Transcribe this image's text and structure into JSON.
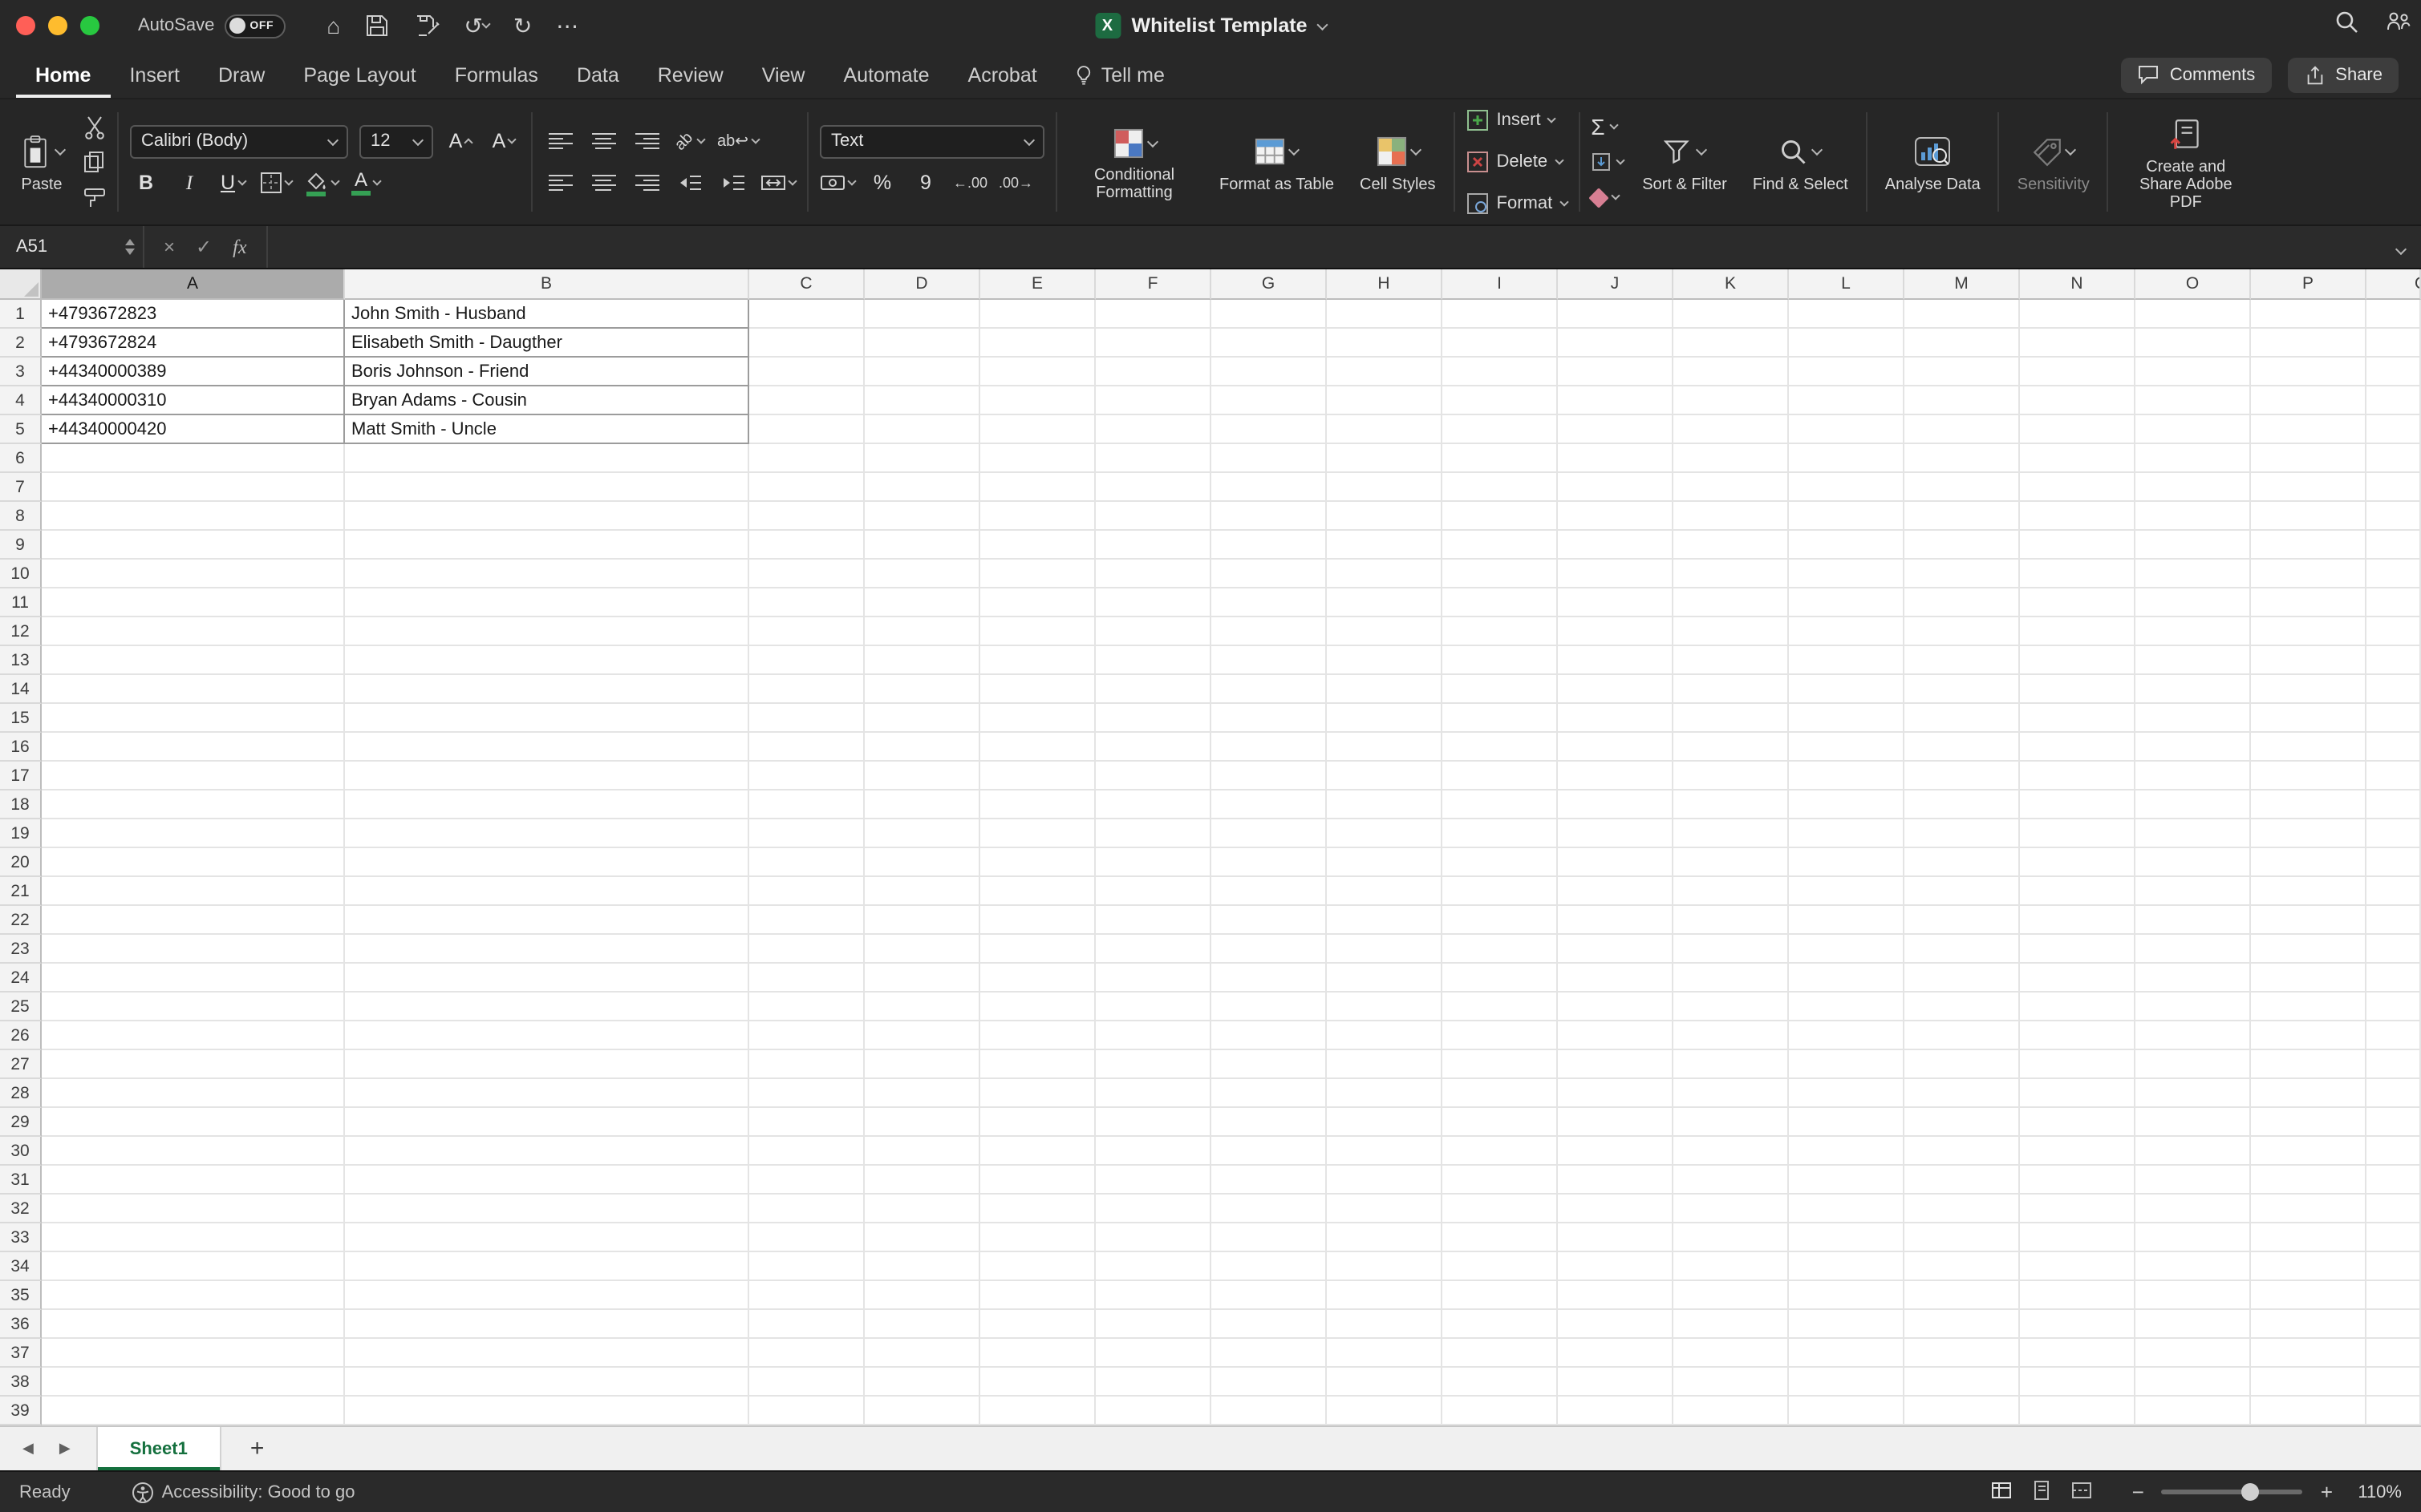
{
  "titlebar": {
    "autosave_label": "AutoSave",
    "autosave_state": "OFF",
    "app_icon_letter": "X",
    "doc_title": "Whitelist Template"
  },
  "menu": {
    "tabs": [
      "Home",
      "Insert",
      "Draw",
      "Page Layout",
      "Formulas",
      "Data",
      "Review",
      "View",
      "Automate",
      "Acrobat",
      "Tell me"
    ],
    "active_tab": "Home",
    "comments_label": "Comments",
    "share_label": "Share"
  },
  "icons": {
    "home": "⌂",
    "undo": "↺",
    "redo": "↻",
    "more": "⋯",
    "cancel": "×",
    "confirm": "✓",
    "fx": "fx",
    "autosum": "Σ",
    "percent": "%",
    "comma": "9",
    "increase_decimal": "←.00",
    "decrease_decimal": ".00→",
    "bold": "B",
    "italic": "I",
    "underline": "U",
    "font_letter": "A",
    "orientation": "ab",
    "wrap": "ab↩",
    "prev_sheet": "◀",
    "next_sheet": "▶",
    "add_sheet": "+",
    "zoom_minus": "−",
    "zoom_plus": "+"
  },
  "ribbon": {
    "paste_label": "Paste",
    "font_name": "Calibri (Body)",
    "font_size": "12",
    "number_format": "Text",
    "conditional_formatting": "Conditional Formatting",
    "format_as_table": "Format as Table",
    "cell_styles": "Cell Styles",
    "insert_label": "Insert",
    "delete_label": "Delete",
    "format_label": "Format",
    "sort_filter": "Sort & Filter",
    "find_select": "Find & Select",
    "analyse_data": "Analyse Data",
    "sensitivity": "Sensitivity",
    "adobe_pdf": "Create and Share Adobe PDF"
  },
  "formula_bar": {
    "name_box": "A51",
    "formula": ""
  },
  "grid": {
    "columns": [
      "A",
      "B",
      "C",
      "D",
      "E",
      "F",
      "G",
      "H",
      "I",
      "J",
      "K",
      "L",
      "M",
      "N",
      "O",
      "P"
    ],
    "partial_column": "Q",
    "row_count": 39,
    "selected_column": "A",
    "data": [
      {
        "row": 1,
        "A": "+4793672823",
        "B": "John Smith - Husband"
      },
      {
        "row": 2,
        "A": "+4793672824",
        "B": "Elisabeth Smith - Daugther"
      },
      {
        "row": 3,
        "A": "+44340000389",
        "B": "Boris Johnson - Friend"
      },
      {
        "row": 4,
        "A": "+44340000310",
        "B": "Bryan Adams - Cousin"
      },
      {
        "row": 5,
        "A": "+44340000420",
        "B": "Matt Smith - Uncle"
      }
    ]
  },
  "sheet_bar": {
    "tabs": [
      "Sheet1"
    ],
    "active_tab": "Sheet1"
  },
  "status_bar": {
    "ready": "Ready",
    "accessibility": "Accessibility: Good to go",
    "zoom": "110%"
  }
}
